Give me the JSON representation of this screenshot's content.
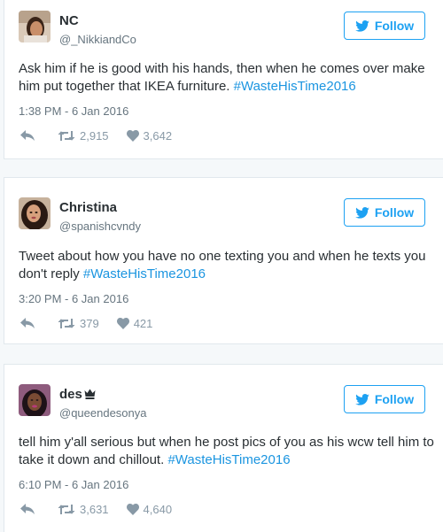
{
  "tweets": [
    {
      "name": "NC",
      "handle": "@_NikkiandCo",
      "follow_label": "Follow",
      "text": "Ask him if he is good with his hands, then when he comes over make him put together that IKEA furniture. ",
      "hashtag": "#WasteHisTime2016",
      "time": "1:38 PM - 6 Jan 2016",
      "retweets": "2,915",
      "likes": "3,642"
    },
    {
      "name": "Christina",
      "handle": "@spanishcvndy",
      "follow_label": "Follow",
      "text": "Tweet about how you have no one texting you and when he texts you don't reply ",
      "hashtag": "#WasteHisTime2016",
      "time": "3:20 PM - 6 Jan 2016",
      "retweets": "379",
      "likes": "421"
    },
    {
      "name": "des",
      "name_icon": "crown-icon",
      "handle": "@queendesonya",
      "follow_label": "Follow",
      "text": "tell him y'all serious but when he post pics of you as his wcw tell him to take it down and chillout. ",
      "hashtag": "#WasteHisTime2016",
      "time": "6:10 PM - 6 Jan 2016",
      "retweets": "3,631",
      "likes": "4,640"
    }
  ],
  "colors": {
    "accent": "#1da1f2",
    "hashtag": "#1b95e0",
    "muted": "#66757f",
    "icon": "#8899a6",
    "background": "#f5f8fa"
  }
}
